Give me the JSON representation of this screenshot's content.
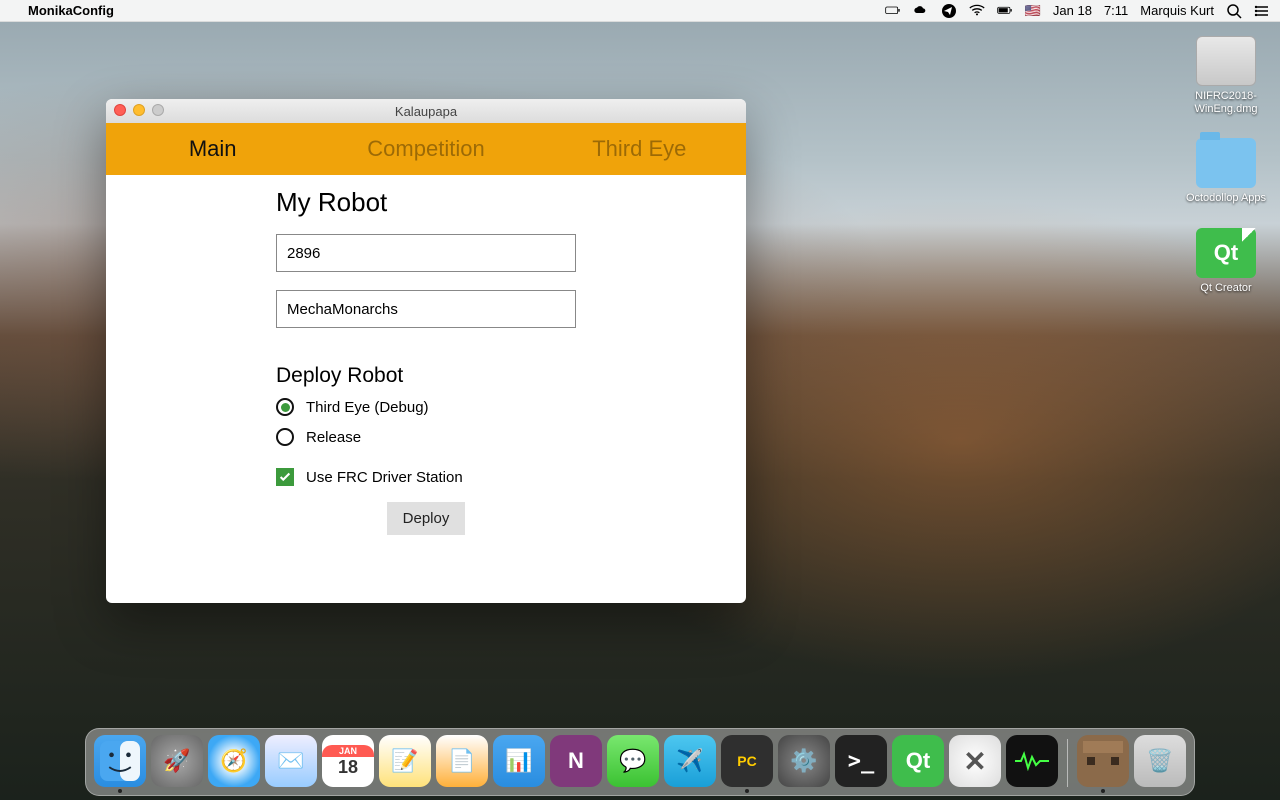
{
  "menubar": {
    "app_name": "MonikaConfig",
    "date": "Jan 18",
    "time": "7:11",
    "user": "Marquis Kurt",
    "flag": "🇺🇸"
  },
  "desktop": {
    "icons": [
      {
        "label": "NIFRC2018-WinEng.dmg",
        "kind": "dmg"
      },
      {
        "label": "Octodollop Apps",
        "kind": "folder"
      },
      {
        "label": "Qt Creator",
        "kind": "qt"
      }
    ]
  },
  "window": {
    "title": "Kalaupapa",
    "tabs": [
      {
        "label": "Main",
        "active": true
      },
      {
        "label": "Competition",
        "active": false
      },
      {
        "label": "Third Eye",
        "active": false
      }
    ],
    "form": {
      "heading": "My Robot",
      "team_number": "2896",
      "team_name": "MechaMonarchs",
      "deploy_heading": "Deploy Robot",
      "radio_options": [
        {
          "label": "Third Eye (Debug)",
          "selected": true
        },
        {
          "label": "Release",
          "selected": false
        }
      ],
      "checkbox": {
        "label": "Use FRC Driver Station",
        "checked": true
      },
      "deploy_button": "Deploy"
    }
  },
  "dock": {
    "cal_month": "JAN",
    "cal_day": "18"
  }
}
